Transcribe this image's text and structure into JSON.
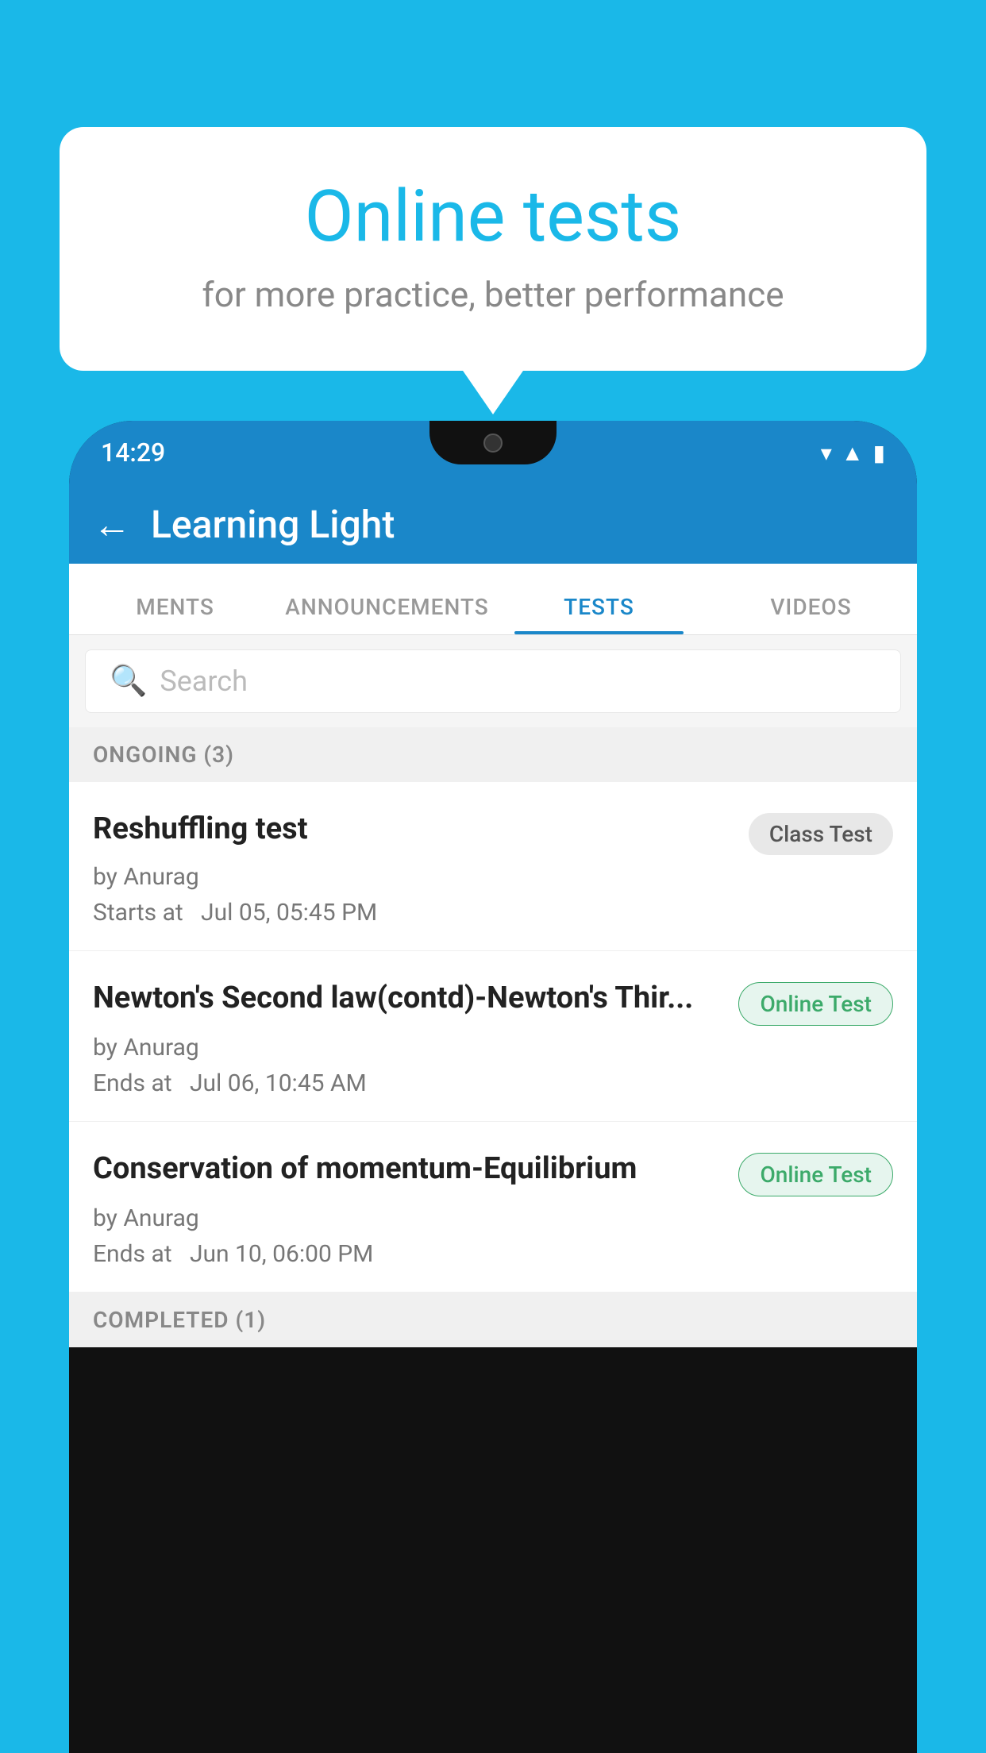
{
  "background": {
    "color": "#1ab8e8"
  },
  "bubble": {
    "title": "Online tests",
    "subtitle": "for more practice, better performance"
  },
  "phone": {
    "status_bar": {
      "time": "14:29",
      "icons": [
        "▾",
        "◀",
        "▮"
      ]
    },
    "header": {
      "back_label": "←",
      "title": "Learning Light"
    },
    "tabs": [
      {
        "label": "MENTS",
        "active": false
      },
      {
        "label": "ANNOUNCEMENTS",
        "active": false
      },
      {
        "label": "TESTS",
        "active": true
      },
      {
        "label": "VIDEOS",
        "active": false
      }
    ],
    "search": {
      "placeholder": "Search"
    },
    "ongoing_section": {
      "label": "ONGOING (3)"
    },
    "tests": [
      {
        "name": "Reshuffling test",
        "badge": "Class Test",
        "badge_type": "class",
        "by": "by Anurag",
        "time_label": "Starts at",
        "time": "Jul 05, 05:45 PM"
      },
      {
        "name": "Newton's Second law(contd)-Newton's Thir...",
        "badge": "Online Test",
        "badge_type": "online",
        "by": "by Anurag",
        "time_label": "Ends at",
        "time": "Jul 06, 10:45 AM"
      },
      {
        "name": "Conservation of momentum-Equilibrium",
        "badge": "Online Test",
        "badge_type": "online",
        "by": "by Anurag",
        "time_label": "Ends at",
        "time": "Jun 10, 06:00 PM"
      }
    ],
    "completed_section": {
      "label": "COMPLETED (1)"
    }
  }
}
